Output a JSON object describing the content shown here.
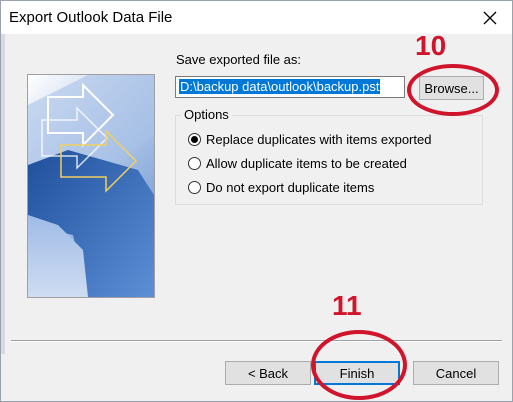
{
  "window": {
    "title": "Export Outlook Data File",
    "close_icon": "close-icon"
  },
  "save": {
    "label": "Save exported file as:",
    "path_value": "D:\\backup data\\outlook\\backup.pst",
    "browse_label": "Browse..."
  },
  "options": {
    "legend": "Options",
    "items": [
      {
        "label": "Replace duplicates with items exported",
        "checked": true
      },
      {
        "label": "Allow duplicate items to be created",
        "checked": false
      },
      {
        "label": "Do not export duplicate items",
        "checked": false
      }
    ]
  },
  "buttons": {
    "back": "< Back",
    "finish": "Finish",
    "cancel": "Cancel"
  },
  "annotations": {
    "step_browse": "10",
    "step_finish": "11",
    "color": "#d0142c"
  },
  "colors": {
    "accent": "#0078d7",
    "dialog_bg": "#f0f0f0"
  }
}
